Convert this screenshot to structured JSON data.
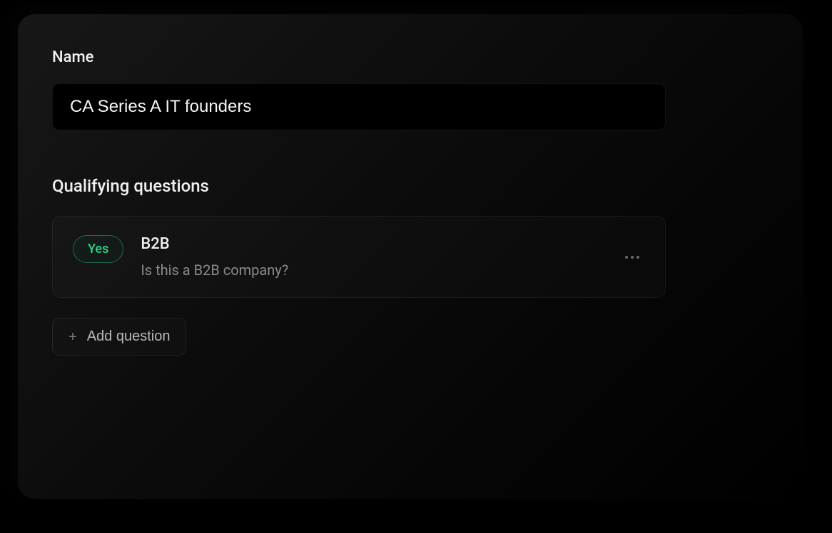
{
  "name_section": {
    "label": "Name",
    "value": "CA Series A IT founders"
  },
  "questions_section": {
    "label": "Qualifying questions",
    "items": [
      {
        "answer_badge": "Yes",
        "title": "B2B",
        "description": "Is this a B2B company?"
      }
    ],
    "add_button_label": "Add question"
  }
}
